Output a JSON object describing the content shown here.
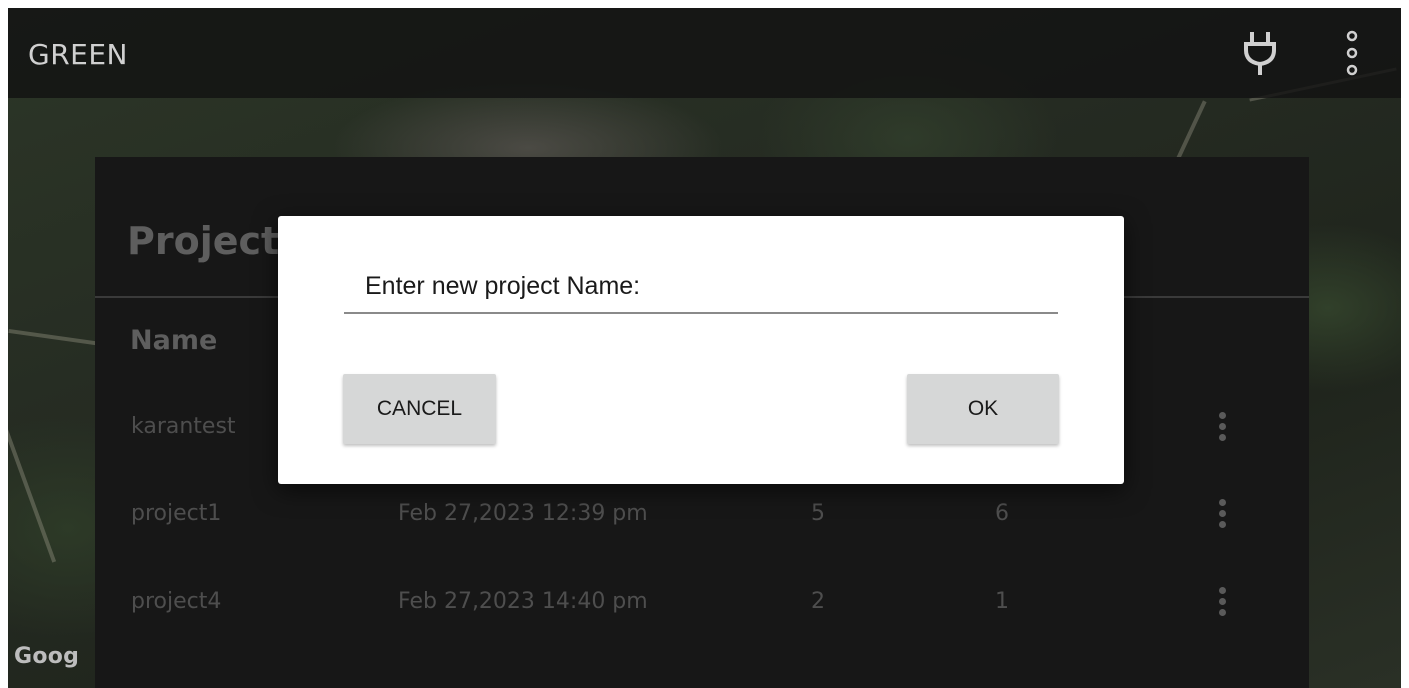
{
  "appbar": {
    "title": "GREEN",
    "plug_icon": "power-plug-icon",
    "overflow_icon": "more-vert-icon"
  },
  "panel": {
    "title": "Project",
    "columns": {
      "name": "Name"
    },
    "rows": [
      {
        "name": "karantest",
        "date": "",
        "a": "",
        "b": ""
      },
      {
        "name": "project1",
        "date": "Feb 27,2023 12:39 pm",
        "a": "5",
        "b": "6"
      },
      {
        "name": "project4",
        "date": "Feb 27,2023 14:40 pm",
        "a": "2",
        "b": "1"
      }
    ]
  },
  "map": {
    "attribution": "Goog"
  },
  "dialog": {
    "prompt": "Enter new project Name:",
    "input_value": "",
    "cancel_label": "CANCEL",
    "ok_label": "OK"
  },
  "colors": {
    "dialog_bg": "#ffffff",
    "button_bg": "#d6d7d7",
    "panel_bg": "#171717"
  }
}
